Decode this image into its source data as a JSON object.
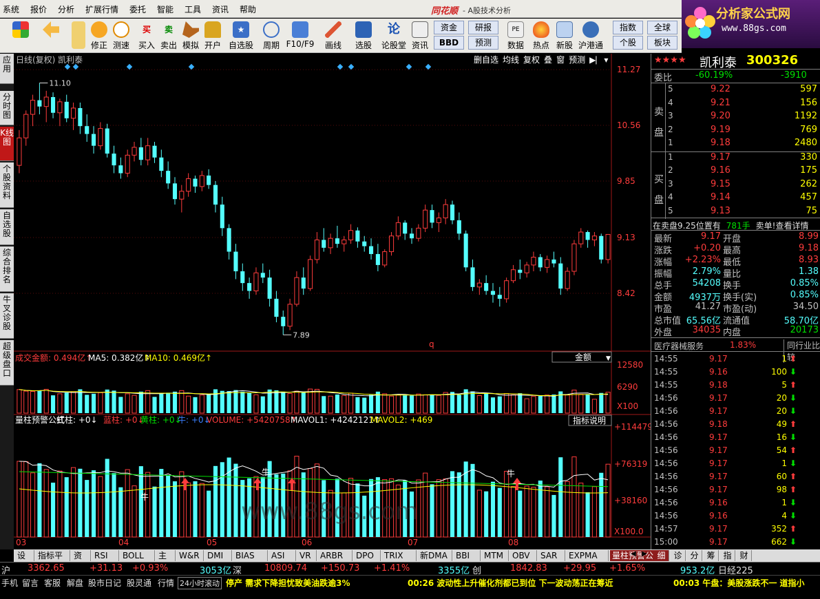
{
  "menubar": {
    "items": [
      "系统",
      "报价",
      "分析",
      "扩展行情",
      "委托",
      "智能",
      "工具",
      "资讯",
      "帮助"
    ],
    "brand": "同花顺",
    "app_title": "- A股技术分析"
  },
  "logo": {
    "title": "分析家公式网",
    "url": "www.88gs.com"
  },
  "toolbar": {
    "buttons": [
      "修正",
      "测速",
      "买入",
      "卖出",
      "模拟",
      "开户",
      "自选股",
      "周期",
      "F10/F9",
      "画线",
      "选股",
      "论股堂",
      "资讯",
      "数据",
      "热点",
      "新股",
      "沪港通"
    ],
    "boxes": [
      "资金",
      "研报",
      "BBD",
      "预测",
      "指数",
      "全球",
      "个股",
      "板块"
    ]
  },
  "left_tabs": [
    "应用",
    "分时图",
    "K线图",
    "个股资料",
    "自选股",
    "综合排名",
    "牛叉诊股",
    "超级盘口"
  ],
  "chart": {
    "title": "日线(复权) 凯利泰",
    "tools": [
      "删自选",
      "均线",
      "复权",
      "叠",
      "窗",
      "预测"
    ],
    "high_label": "11.10",
    "low_label": "7.89",
    "price_ticks": [
      "11.27",
      "10.56",
      "9.85",
      "9.13",
      "8.42"
    ],
    "q_marker": "q",
    "vol_header": {
      "name": "成交金额: 0.494亿↑",
      "ma5": "MA5: 0.382亿↑",
      "ma10": "MA10: 0.469亿↑",
      "dropdown": "金额"
    },
    "vol_ticks": [
      "12580",
      "6290",
      "X100"
    ],
    "ind_header": {
      "name": "量柱预警公式",
      "p1": "红柱: +0↓",
      "p2": "蓝柱: +0↓",
      "p3": "黄柱: +0↓",
      "p4": "牛: +0↓",
      "p5": "VOLUME: +5420758↑",
      "p6": "MAVOL1: +4242121↑",
      "p7": "MAVOL2: +469",
      "button": "指标说明"
    },
    "ind_ticks": [
      "+114479",
      "+76319",
      "+38160",
      "X100.0"
    ],
    "months": [
      "03",
      "04",
      "05",
      "06",
      "07",
      "08"
    ],
    "niu": "牛",
    "watermark": "www.88gs.com"
  },
  "chart_data": {
    "type": "candlestick",
    "title": "日线(复权) 凯利泰",
    "ylim": [
      7.7,
      11.35
    ],
    "y_ticks": [
      11.27,
      10.56,
      9.85,
      9.13,
      8.42
    ],
    "x_labels": [
      "03",
      "04",
      "05",
      "06",
      "07",
      "08"
    ],
    "ohlc": [
      [
        10.05,
        10.5,
        9.95,
        10.4
      ],
      [
        10.4,
        10.75,
        10.3,
        10.7
      ],
      [
        10.7,
        10.95,
        10.55,
        10.88
      ],
      [
        10.88,
        11.1,
        10.7,
        10.8
      ],
      [
        10.8,
        11.0,
        10.6,
        10.92
      ],
      [
        10.92,
        10.98,
        10.65,
        10.72
      ],
      [
        10.72,
        10.9,
        10.55,
        10.86
      ],
      [
        10.86,
        10.95,
        10.6,
        10.65
      ],
      [
        10.65,
        10.85,
        10.5,
        10.78
      ],
      [
        10.78,
        10.85,
        10.45,
        10.55
      ],
      [
        10.55,
        10.7,
        10.35,
        10.45
      ],
      [
        10.45,
        10.55,
        10.2,
        10.3
      ],
      [
        10.3,
        10.6,
        10.25,
        10.52
      ],
      [
        10.52,
        10.58,
        10.15,
        10.2
      ],
      [
        10.2,
        10.3,
        9.95,
        10.05
      ],
      [
        10.05,
        10.15,
        9.88,
        9.95
      ],
      [
        9.95,
        10.25,
        9.9,
        10.18
      ],
      [
        10.18,
        10.35,
        10.1,
        10.28
      ],
      [
        10.28,
        10.4,
        10.05,
        10.12
      ],
      [
        10.12,
        10.4,
        10.05,
        10.3
      ],
      [
        10.3,
        10.35,
        10.08,
        10.15
      ],
      [
        10.15,
        10.25,
        9.9,
        9.98
      ],
      [
        9.98,
        10.1,
        9.75,
        9.82
      ],
      [
        9.82,
        9.9,
        9.55,
        9.62
      ],
      [
        9.62,
        9.8,
        9.45,
        9.72
      ],
      [
        9.72,
        9.95,
        9.65,
        9.88
      ],
      [
        9.88,
        9.92,
        9.7,
        9.78
      ],
      [
        9.78,
        9.98,
        9.72,
        9.92
      ],
      [
        9.92,
        10.0,
        9.75,
        9.8
      ],
      [
        9.8,
        9.85,
        9.45,
        9.55
      ],
      [
        9.55,
        9.65,
        9.15,
        9.25
      ],
      [
        9.25,
        9.3,
        8.85,
        8.95
      ],
      [
        8.95,
        9.05,
        8.6,
        8.7
      ],
      [
        8.7,
        8.8,
        8.45,
        8.55
      ],
      [
        8.55,
        8.62,
        8.35,
        8.45
      ],
      [
        8.45,
        8.75,
        8.4,
        8.68
      ],
      [
        8.68,
        8.8,
        8.55,
        8.62
      ],
      [
        8.62,
        8.72,
        8.25,
        8.35
      ],
      [
        8.35,
        8.45,
        8.05,
        8.12
      ],
      [
        8.12,
        8.2,
        7.89,
        8.0
      ],
      [
        8.0,
        8.35,
        7.95,
        8.28
      ],
      [
        8.28,
        8.7,
        8.25,
        8.62
      ],
      [
        8.62,
        8.75,
        8.4,
        8.48
      ],
      [
        8.48,
        8.9,
        8.45,
        8.85
      ],
      [
        8.85,
        9.2,
        8.8,
        9.1
      ],
      [
        9.1,
        9.25,
        8.95,
        9.0
      ],
      [
        9.0,
        9.18,
        8.92,
        9.12
      ],
      [
        9.12,
        9.28,
        9.0,
        9.05
      ],
      [
        9.05,
        9.15,
        8.95,
        9.1
      ],
      [
        9.1,
        9.3,
        9.05,
        9.22
      ],
      [
        9.22,
        9.26,
        9.0,
        9.08
      ],
      [
        9.08,
        9.15,
        8.95,
        9.02
      ],
      [
        9.02,
        9.12,
        8.85,
        8.92
      ],
      [
        8.92,
        9.05,
        8.7,
        8.78
      ],
      [
        8.78,
        8.98,
        8.75,
        8.95
      ],
      [
        8.95,
        9.2,
        8.9,
        9.15
      ],
      [
        9.15,
        9.4,
        9.1,
        9.32
      ],
      [
        9.32,
        9.35,
        9.1,
        9.18
      ],
      [
        9.18,
        9.25,
        9.05,
        9.12
      ],
      [
        9.12,
        9.3,
        9.08,
        9.25
      ],
      [
        9.25,
        9.55,
        9.2,
        9.48
      ],
      [
        9.48,
        9.55,
        9.25,
        9.32
      ],
      [
        9.32,
        9.45,
        9.2,
        9.38
      ],
      [
        9.38,
        9.62,
        9.3,
        9.55
      ],
      [
        9.55,
        9.6,
        9.3,
        9.35
      ],
      [
        9.35,
        9.45,
        9.1,
        9.18
      ],
      [
        9.18,
        9.22,
        8.7,
        8.75
      ],
      [
        8.75,
        8.85,
        8.45,
        8.5
      ],
      [
        8.5,
        8.6,
        8.4,
        8.55
      ],
      [
        8.55,
        8.65,
        8.4,
        8.45
      ],
      [
        8.45,
        8.55,
        8.3,
        8.4
      ],
      [
        8.4,
        8.5,
        8.25,
        8.35
      ],
      [
        8.35,
        8.62,
        8.3,
        8.58
      ],
      [
        8.58,
        8.78,
        8.55,
        8.72
      ],
      [
        8.72,
        8.85,
        8.6,
        8.68
      ],
      [
        8.68,
        8.82,
        8.62,
        8.78
      ],
      [
        8.78,
        8.95,
        8.7,
        8.88
      ],
      [
        8.88,
        8.92,
        8.7,
        8.75
      ],
      [
        8.75,
        8.9,
        8.68,
        8.85
      ],
      [
        8.85,
        8.95,
        8.75,
        8.8
      ],
      [
        8.8,
        8.88,
        8.4,
        8.48
      ],
      [
        8.48,
        8.75,
        8.45,
        8.7
      ],
      [
        8.7,
        9.1,
        8.65,
        9.05
      ],
      [
        9.05,
        9.25,
        9.0,
        9.2
      ],
      [
        9.2,
        9.22,
        9.0,
        9.1
      ],
      [
        9.1,
        9.2,
        9.02,
        9.15
      ],
      [
        9.15,
        9.18,
        8.8,
        8.85
      ],
      [
        8.85,
        9.17,
        8.8,
        9.17
      ]
    ]
  },
  "quote": {
    "stars": "★★★★",
    "name": "凯利泰",
    "code": "300326",
    "weibi_label": "委比",
    "weibi": "-60.19%",
    "weicha": "-3910",
    "sell_label": "卖盘",
    "buy_label": "买盘",
    "sell": [
      [
        "5",
        "9.22",
        "597"
      ],
      [
        "4",
        "9.21",
        "156"
      ],
      [
        "3",
        "9.20",
        "1192"
      ],
      [
        "2",
        "9.19",
        "769"
      ],
      [
        "1",
        "9.18",
        "2480"
      ]
    ],
    "buy": [
      [
        "1",
        "9.17",
        "330"
      ],
      [
        "2",
        "9.16",
        "175"
      ],
      [
        "3",
        "9.15",
        "262"
      ],
      [
        "4",
        "9.14",
        "457"
      ],
      [
        "5",
        "9.13",
        "75"
      ]
    ],
    "notice_a": "在卖盘9.25位置有",
    "notice_b": "781手",
    "notice_c": "卖单!",
    "notice_d": "查看详情",
    "stats": [
      [
        "最新",
        "9.17",
        "开盘",
        "8.99"
      ],
      [
        "涨跌",
        "+0.20",
        "最高",
        "9.18"
      ],
      [
        "涨幅",
        "+2.23%",
        "最低",
        "8.93"
      ],
      [
        "振幅",
        "2.79%",
        "量比",
        "1.38"
      ],
      [
        "总手",
        "54208",
        "换手",
        "0.85%"
      ],
      [
        "金额",
        "4937万",
        "换手(实)",
        "0.85%"
      ],
      [
        "市盈",
        "41.27",
        "市盈(动)",
        "34.50"
      ],
      [
        "总市值",
        "65.56亿",
        "流通值",
        "58.70亿"
      ],
      [
        "外盘",
        "34035",
        "内盘",
        "20173"
      ]
    ],
    "sector": "医疗器械服务",
    "sector_pct": "1.83%",
    "sector_btn": "同行业比较",
    "ticks": [
      [
        "14:55",
        "9.17",
        "1",
        "up"
      ],
      [
        "14:55",
        "9.16",
        "100",
        "dn"
      ],
      [
        "14:55",
        "9.18",
        "5",
        "up"
      ],
      [
        "14:56",
        "9.17",
        "20",
        "dn"
      ],
      [
        "14:56",
        "9.17",
        "20",
        "dn"
      ],
      [
        "14:56",
        "9.18",
        "49",
        "up"
      ],
      [
        "14:56",
        "9.17",
        "16",
        "dn"
      ],
      [
        "14:56",
        "9.17",
        "54",
        "up"
      ],
      [
        "14:56",
        "9.17",
        "1",
        "dn"
      ],
      [
        "14:56",
        "9.17",
        "60",
        "up"
      ],
      [
        "14:56",
        "9.17",
        "98",
        "up"
      ],
      [
        "14:56",
        "9.16",
        "1",
        "dn"
      ],
      [
        "14:56",
        "9.16",
        "4",
        "dn"
      ],
      [
        "14:57",
        "9.17",
        "352",
        "up"
      ],
      [
        "15:00",
        "9.17",
        "662",
        "dn"
      ]
    ]
  },
  "bottom_tabs": [
    "设置",
    "指标平台",
    "资讯",
    "RSI",
    "BOLL",
    "主力",
    "W&R",
    "DMI",
    "BIAS",
    "ASI",
    "VR",
    "ARBR",
    "DPO",
    "TRIX",
    "新DMA",
    "BBI",
    "MTM",
    "OBV",
    "SAR",
    "EXPMA",
    "量柱预警公式"
  ],
  "bottom_right_tabs": [
    "细",
    "诊",
    "分",
    "筹",
    "指",
    "财"
  ],
  "index_bar": {
    "sh_label": "沪",
    "sh_val": "3362.65",
    "sh_chg": "+31.13",
    "sh_pct": "+0.93%",
    "sh_amt": "3053亿",
    "sz_label": "深",
    "sz_val": "10809.74",
    "sz_chg": "+150.73",
    "sz_pct": "+1.41%",
    "sz_amt": "3355亿",
    "cy_label": "创",
    "cy_val": "1842.83",
    "cy_chg": "+29.95",
    "cy_pct": "+1.65%",
    "cy_amt": "953.2亿",
    "nk_label": "日经225"
  },
  "status_bar": {
    "items": [
      "手机",
      "留言",
      "客服",
      "解盘",
      "股市日记",
      "股灵通",
      "行情",
      "24小时滚动"
    ],
    "news1": "停产 需求下降担忧致美油跌逾3%",
    "news2": "00:26 波动性上升催化剂都已到位 下一波动荡正在筹近",
    "news3": "00:03 午盘：美股涨跌不一 道指小"
  }
}
